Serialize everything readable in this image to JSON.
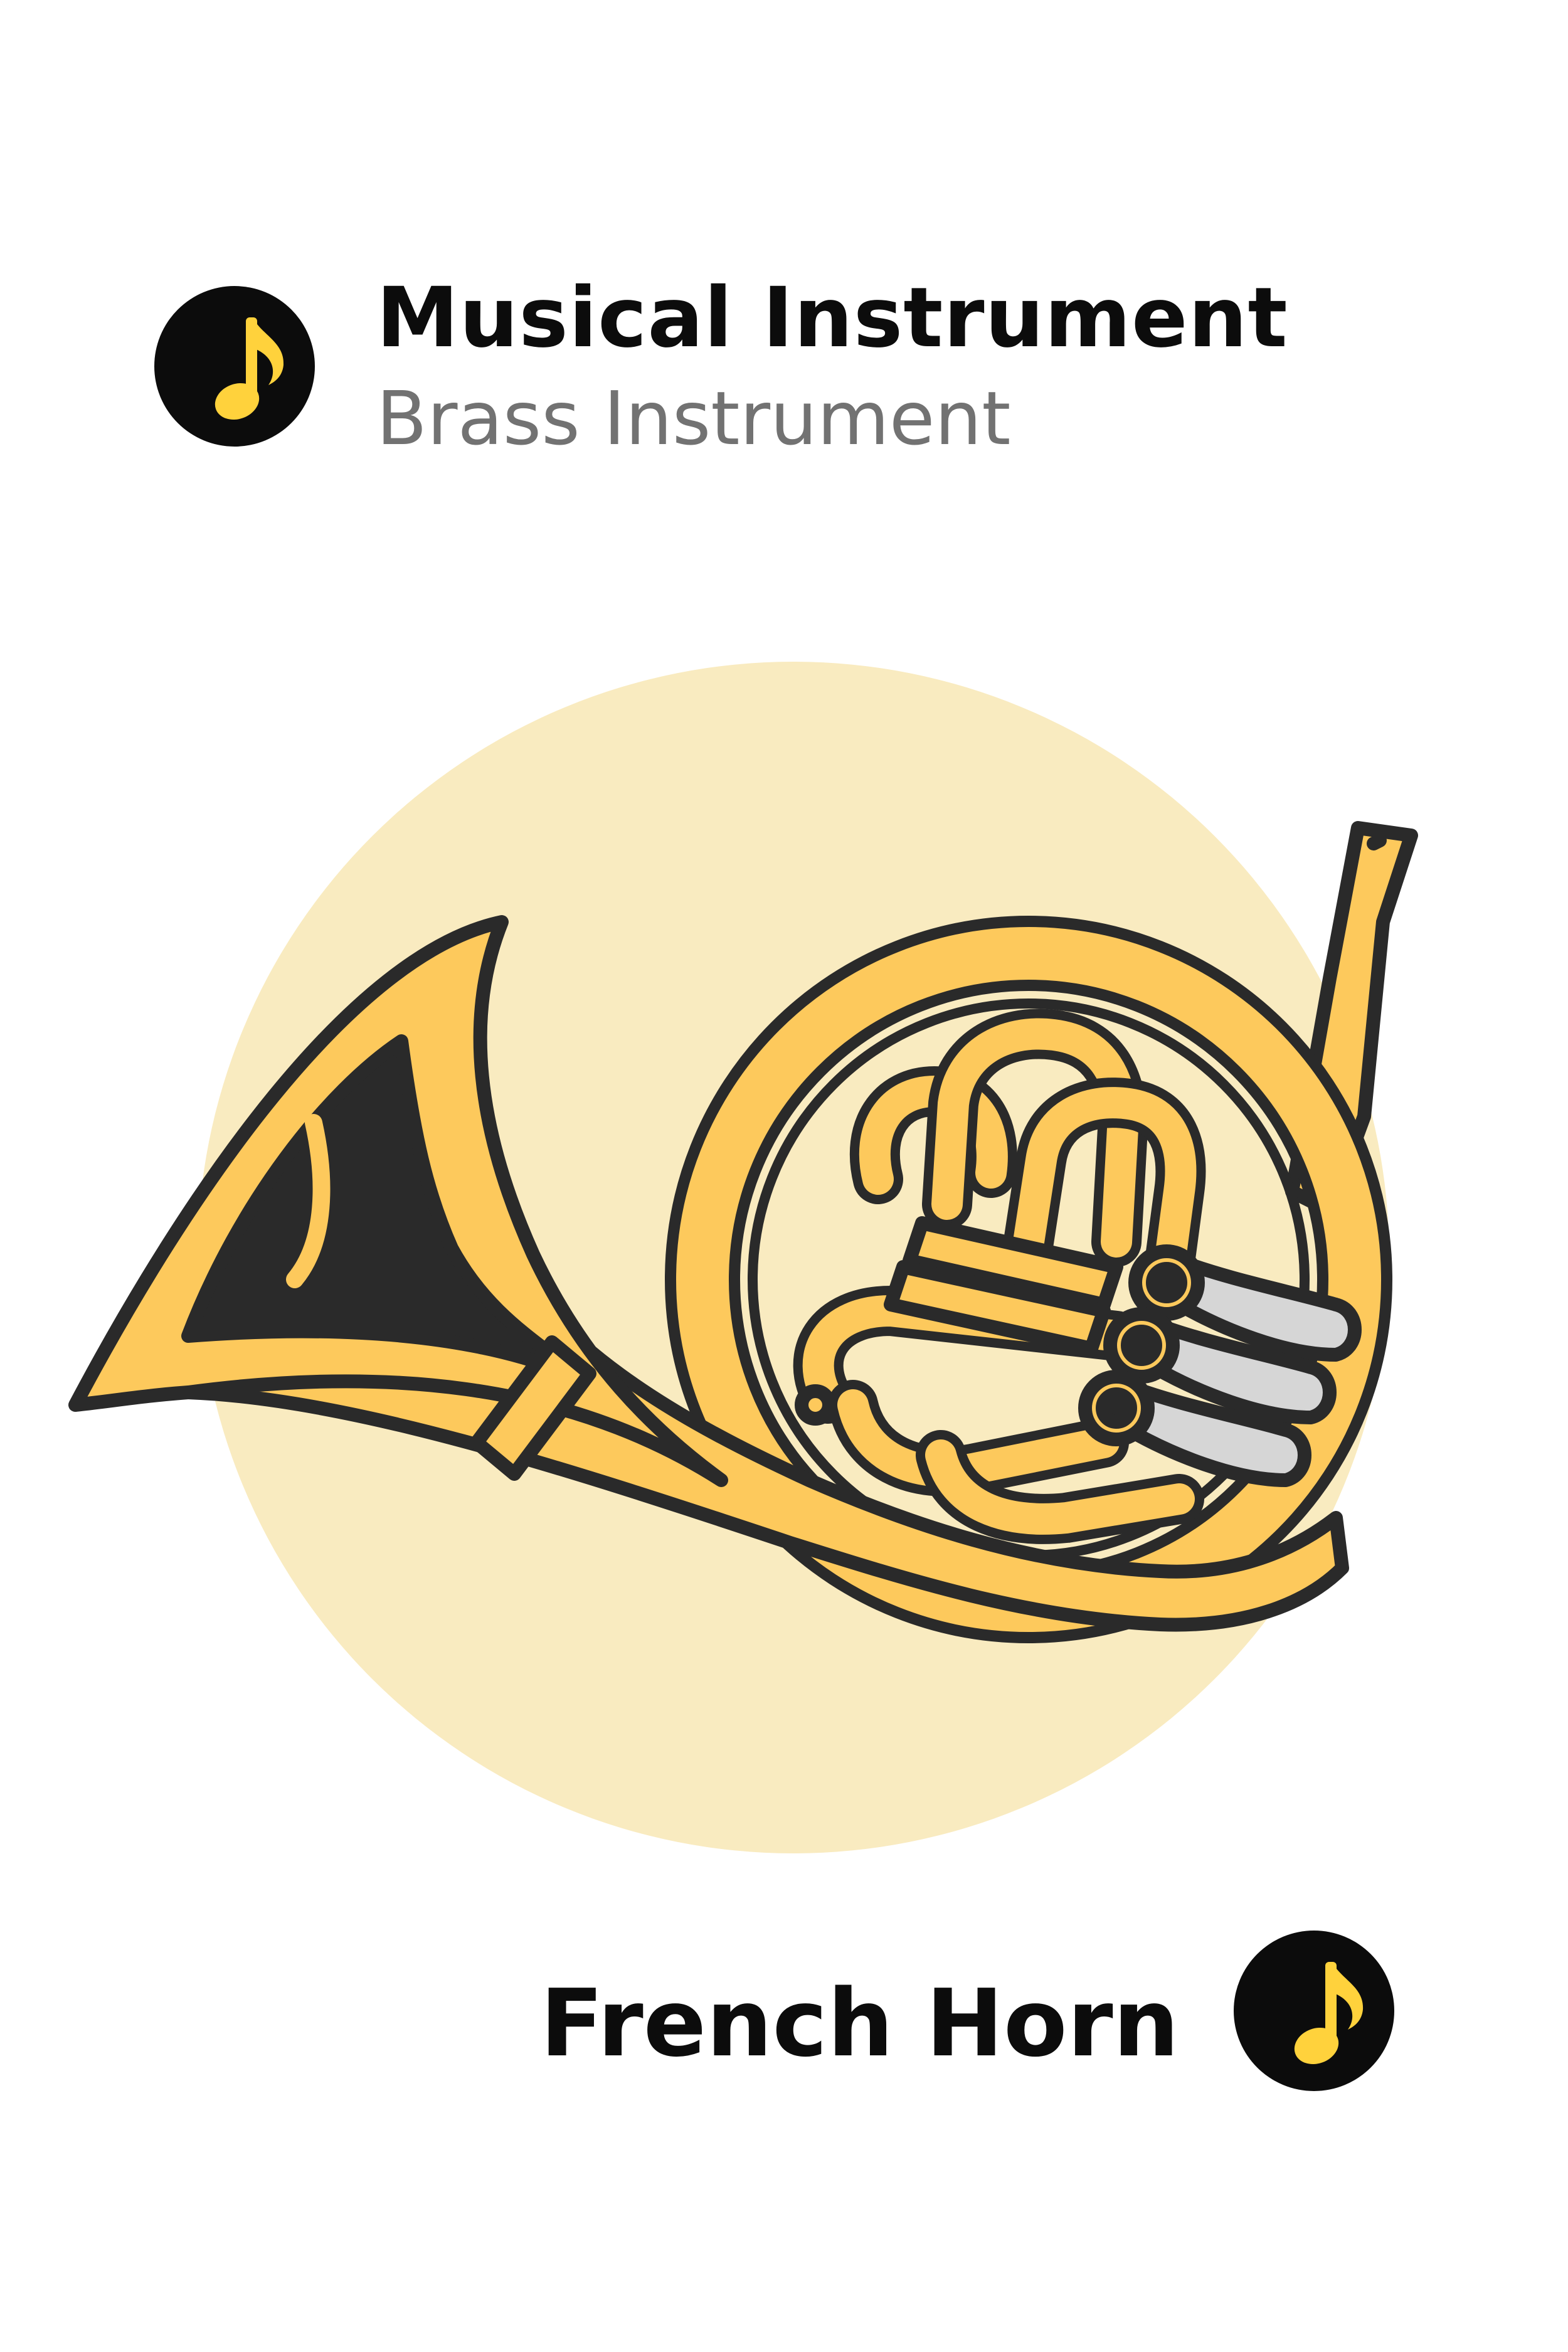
{
  "header": {
    "title": "Musical Instrument",
    "subtitle": "Brass Instrument",
    "badge_icon": "music-note-icon"
  },
  "footer": {
    "name": "French Horn",
    "badge_icon": "music-note-icon"
  },
  "illustration": {
    "subject": "french-horn-icon",
    "colors": {
      "background_circle": "#f9ebc0",
      "brass": "#fdc95c",
      "outline": "#2a2a2a",
      "valve_keys": "#d6d6d6",
      "note": "#ffd23c",
      "badge": "#0c0c0c"
    }
  }
}
